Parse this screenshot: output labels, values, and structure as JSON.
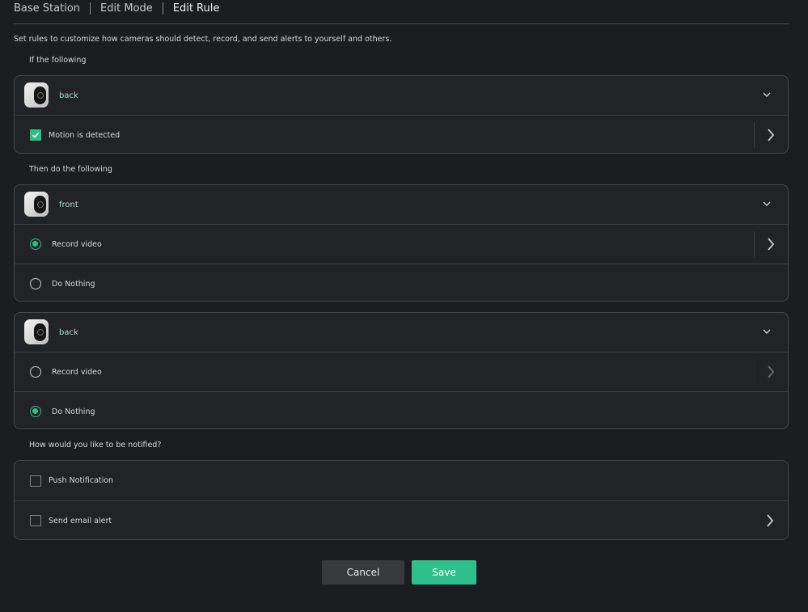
{
  "breadcrumb": [
    "Base Station",
    "Edit Mode",
    "Edit Rule"
  ],
  "intro": "Set rules to customize how cameras should detect, record, and send alerts to yourself and others.",
  "if_section": {
    "label": "If the following",
    "device": "back",
    "trigger_label": "Motion is detected",
    "trigger_checked": true
  },
  "then_section": {
    "label": "Then do the following",
    "devices": [
      {
        "name": "front",
        "options": [
          "Record video",
          "Do Nothing"
        ],
        "selected": "Record video"
      },
      {
        "name": "back",
        "options": [
          "Record video",
          "Do Nothing"
        ],
        "selected": "Do Nothing"
      }
    ]
  },
  "notify_section": {
    "label": "How would you like to be notified?",
    "options": [
      {
        "label": "Push Notification",
        "checked": false
      },
      {
        "label": "Send email alert",
        "checked": false
      }
    ]
  },
  "buttons": {
    "cancel": "Cancel",
    "save": "Save"
  },
  "colors": {
    "accent": "#2ec08c",
    "device_name": "#9fe3cf",
    "background": "#1c1d20"
  },
  "icons": [
    "camera-thumbnail-icon",
    "chevron-down-icon",
    "chevron-right-icon",
    "checkmark-icon"
  ]
}
